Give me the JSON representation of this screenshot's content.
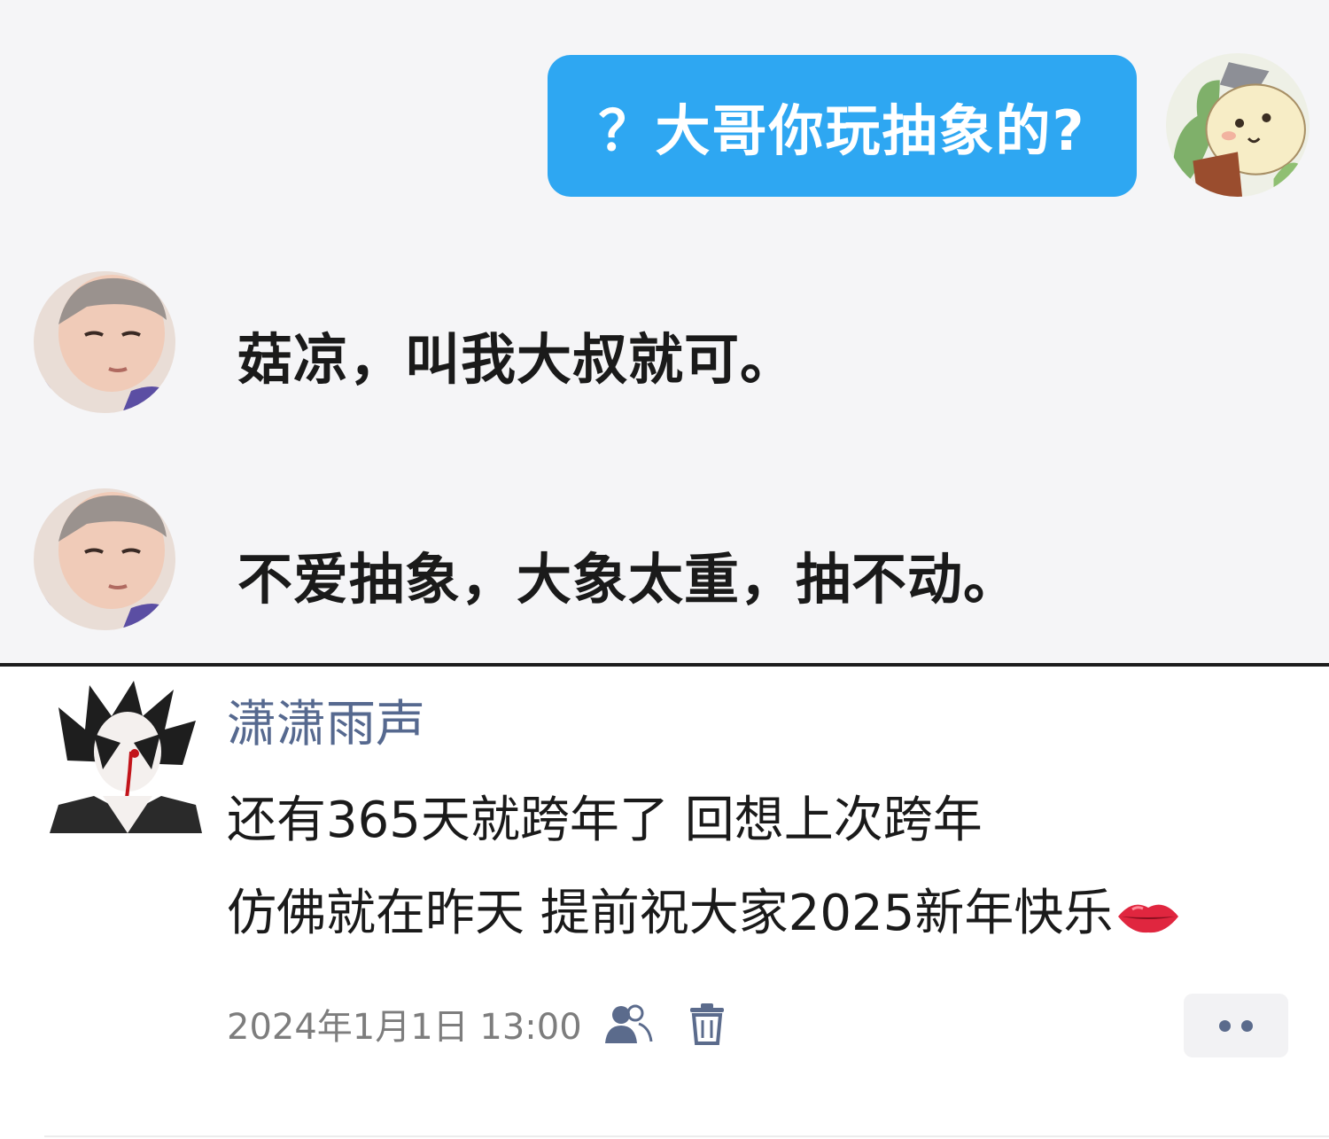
{
  "chat": {
    "outgoing_message": "？大哥你玩抽象的?",
    "incoming_messages": [
      {
        "text": "菇凉，叫我大叔就可。"
      },
      {
        "text": "不爱抽象，大象太重，抽不动。"
      }
    ],
    "colors": {
      "bubble": "#2ea7f2",
      "panel_bg": "#f5f5f7"
    }
  },
  "post": {
    "username": "潇潇雨声",
    "lines": [
      "还有365天就跨年了 回想上次跨年",
      "仿佛就在昨天 提前祝大家2025新年快乐"
    ],
    "emoji": "lips-icon",
    "timestamp": "2024年1月1日 13:00",
    "colors": {
      "username": "#56698f",
      "timestamp": "#7d7d7d"
    }
  },
  "icons": [
    "friends-icon",
    "trash-icon",
    "more-dots-icon"
  ]
}
